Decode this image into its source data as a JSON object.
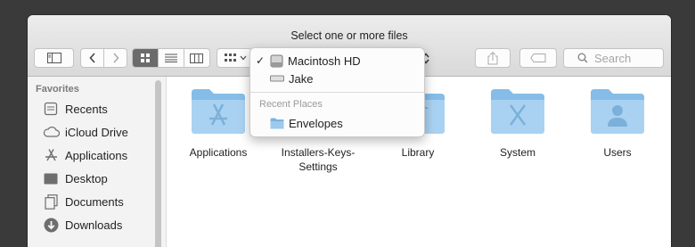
{
  "window": {
    "title": "Select one or more files"
  },
  "toolbar": {
    "sidebar_toggle_icon": "sidebar-icon",
    "back_icon": "chevron-left-icon",
    "forward_icon": "chevron-right-icon",
    "view_modes": [
      "icon-view",
      "list-view",
      "column-view"
    ],
    "active_view": "icon-view",
    "group_icon": "group-icon",
    "share_icon": "share-icon",
    "tag_icon": "tag-icon",
    "search_placeholder": "Search"
  },
  "location_popup": {
    "items": [
      {
        "label": "Macintosh HD",
        "icon": "hard-drive-icon",
        "checked": true
      },
      {
        "label": "Jake",
        "icon": "external-drive-icon",
        "checked": false
      }
    ],
    "recent_header": "Recent Places",
    "recent_items": [
      {
        "label": "Envelopes",
        "icon": "folder-icon"
      }
    ]
  },
  "sidebar": {
    "section_title": "Favorites",
    "items": [
      {
        "label": "Recents",
        "icon": "recents-icon"
      },
      {
        "label": "iCloud Drive",
        "icon": "cloud-icon"
      },
      {
        "label": "Applications",
        "icon": "applications-icon"
      },
      {
        "label": "Desktop",
        "icon": "desktop-icon"
      },
      {
        "label": "Documents",
        "icon": "documents-icon"
      },
      {
        "label": "Downloads",
        "icon": "downloads-icon"
      }
    ]
  },
  "files": [
    {
      "label": "Applications",
      "icon": "applications-folder-icon"
    },
    {
      "label": "Installers-Keys-Settings",
      "icon": "folder-icon"
    },
    {
      "label": "Library",
      "icon": "library-folder-icon"
    },
    {
      "label": "System",
      "icon": "system-folder-icon"
    },
    {
      "label": "Users",
      "icon": "users-folder-icon"
    }
  ],
  "colors": {
    "folder": "#86bde8",
    "folder_light": "#a9d2f2",
    "active_segment": "#6b6b6b"
  }
}
